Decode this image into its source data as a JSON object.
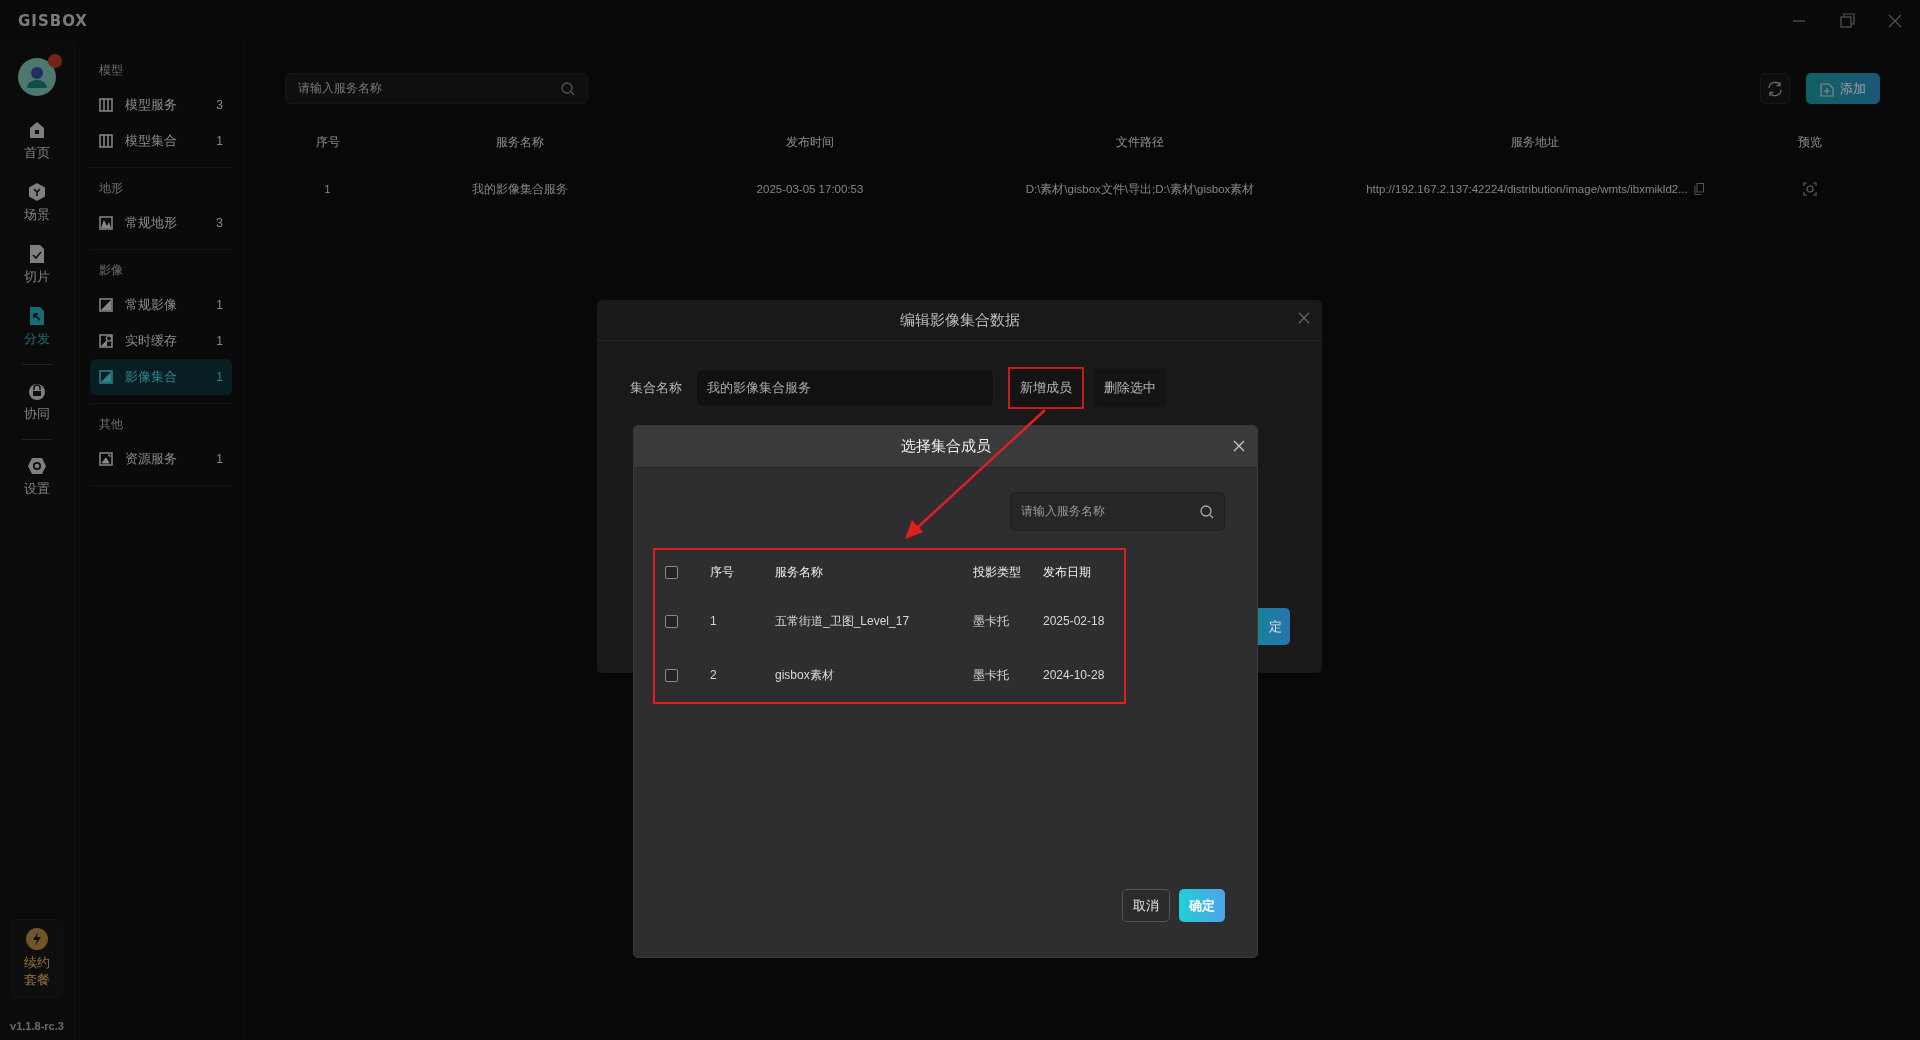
{
  "app": {
    "logo": "GISBOX"
  },
  "rail": {
    "groups": [
      {
        "items": [
          {
            "label": "首页",
            "selected": false
          },
          {
            "label": "场景",
            "selected": false
          },
          {
            "label": "切片",
            "selected": false
          },
          {
            "label": "分发",
            "selected": true
          }
        ]
      },
      {
        "items": [
          {
            "label": "协同",
            "selected": false
          }
        ]
      },
      {
        "items": [
          {
            "label": "设置",
            "selected": false
          }
        ]
      }
    ],
    "promo": {
      "label": "续约套餐"
    },
    "version": "v1.1.8-rc.3"
  },
  "sidebar": {
    "sections": [
      {
        "title": "模型",
        "items": [
          {
            "label": "模型服务",
            "count": "3",
            "selected": false
          },
          {
            "label": "模型集合",
            "count": "1",
            "selected": false
          }
        ]
      },
      {
        "title": "地形",
        "items": [
          {
            "label": "常规地形",
            "count": "3",
            "selected": false
          }
        ]
      },
      {
        "title": "影像",
        "items": [
          {
            "label": "常规影像",
            "count": "1",
            "selected": false
          },
          {
            "label": "实时缓存",
            "count": "1",
            "selected": false
          },
          {
            "label": "影像集合",
            "count": "1",
            "selected": true
          }
        ]
      },
      {
        "title": "其他",
        "items": [
          {
            "label": "资源服务",
            "count": "1",
            "selected": false
          }
        ]
      }
    ]
  },
  "toolbar": {
    "search": {
      "placeholder": "请输入服务名称"
    },
    "add_button": "添加"
  },
  "table": {
    "columns": [
      "序号",
      "服务名称",
      "发布时间",
      "文件路径",
      "服务地址",
      "预览"
    ],
    "rows": [
      {
        "cells": [
          "1",
          "我的影像集合服务",
          "2025-03-05 17:00:53",
          "D:\\素材\\gisbox文件\\导出;D:\\素材\\gisbox素材",
          "http://192.167.2.137:42224/distribution/image/wmts/ibxmikld2..."
        ]
      }
    ]
  },
  "edit_dialog": {
    "title": "编辑影像集合数据",
    "name_label": "集合名称",
    "name_value": "我的影像集合服务",
    "buttons": [
      "新增成员",
      "删除选中"
    ],
    "confirm_partial": "定"
  },
  "member_dialog": {
    "title": "选择集合成员",
    "search": {
      "placeholder": "请输入服务名称"
    },
    "select_all": {
      "checked": false
    },
    "columns": [
      "序号",
      "服务名称",
      "投影类型",
      "发布日期"
    ],
    "rows": [
      {
        "checked": false,
        "cells": [
          "1",
          "五常街道_卫图_Level_17",
          "墨卡托",
          "2025-02-18"
        ]
      },
      {
        "checked": false,
        "cells": [
          "2",
          "gisbox素材",
          "墨卡托",
          "2024-10-28"
        ]
      }
    ],
    "buttons": [
      {
        "label": "取消",
        "kind": "secondary"
      },
      {
        "label": "确定",
        "kind": "primary"
      }
    ]
  }
}
